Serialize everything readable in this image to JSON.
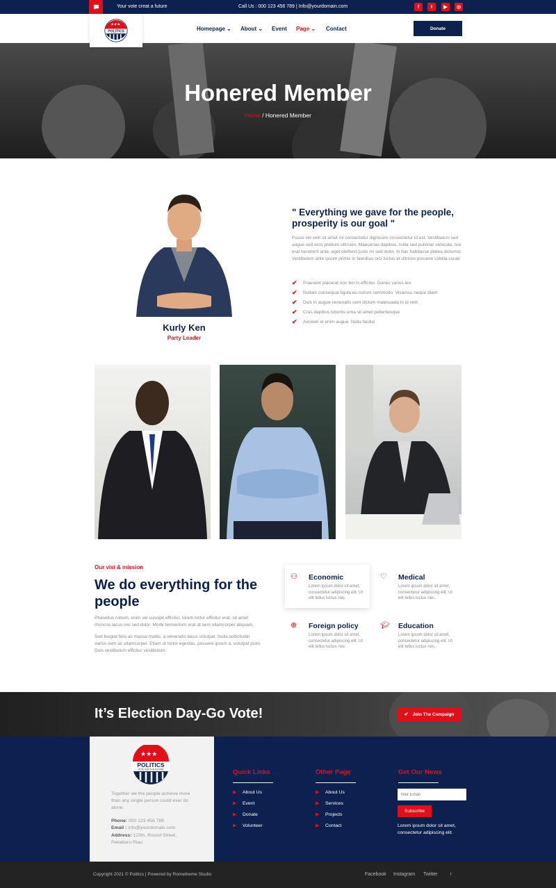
{
  "topbar": {
    "tagline": "Your vote creat a future",
    "contact": "Call Us : 000 123 456 789 | Info@yourdomain.com",
    "social": [
      "facebook-icon",
      "twitter-icon",
      "youtube-icon",
      "instagram-icon"
    ]
  },
  "nav": {
    "items": [
      "Homepage",
      "About",
      "Event",
      "Page",
      "Contact"
    ],
    "donate": "Donate"
  },
  "logo": {
    "text": "POLITICS",
    "tag": "VOTE FOR THE FUTURE"
  },
  "hero": {
    "title": "Honered Member",
    "breadcrumb_home": "Home",
    "breadcrumb_sep": " / ",
    "breadcrumb_current": "Honered Member"
  },
  "leader": {
    "name": "Kurly Ken",
    "role": "Party Leader",
    "quote": "\" Everything we gave for the people, prosperity is our goal \"",
    "intro": "Fusce vel velit sit amet mi consectetur dignissim consectetur id est. Vestibulum sed augue sed eros pretium ultricies. Maecenas dapibus, nulla sed pulvinar vehicula, nisi erat hendrerit ante, eget eleifend justo mi sed dolor. In hac habitasse platea dictumst. Vestibulum ante ipsum primis in faucibus orci luctus et ultrices posuere cubilia curae",
    "checks": [
      "Praesent placerat non leo in efficitur. Donec varius leo",
      "Nullam consequat ligula eu rutrum commodo. Vivamus neque diam",
      "Duis in augue venenatis sem dictum malesuada in id velit",
      "Cras dapibus lobortis urna sit amet pellentesque",
      "Aenean et enim augue. Nulla facilisi"
    ]
  },
  "mission": {
    "label": "Our visi & mission",
    "title": "We do everything for the people",
    "p1": "Phasellus rutrum, enim vel suscipit efficitur, lorem tortor efficitur erat, sit amet rhoncus lacus nisi sed dolor. Morbi fermentum erat at sem ullamcorper aliquam.",
    "p2": "Sed feugiat felis ac massa mattis, a venenatis lacus volutpat. Nulla sollicitudin varius sem ac ullamcorper. Etiam ut tortor egestas, posuere ipsum a, volutpat justo. Duis vestibulum efficitur vestibulum.",
    "services": [
      {
        "title": "Economic",
        "desc": "Lorem ipsum dolor sit amet, consectetur adipiscing elit. Ut elit tellus luctus nec."
      },
      {
        "title": "Medical",
        "desc": "Lorem ipsum dolor sit amet, consectetur adipiscing elit. Ut elit tellus luctus nec."
      },
      {
        "title": "Foreign policy",
        "desc": "Lorem ipsum dolor sit amet, consectetur adipiscing elit. Ut elit tellus luctus nec."
      },
      {
        "title": "Education",
        "desc": "Lorem ipsum dolor sit amet, consectetur adipiscing elit. Ut elit tellus luctus nec."
      }
    ]
  },
  "cta": {
    "title": "It’s Election Day-Go Vote!",
    "button": "Join The Campaign"
  },
  "footer": {
    "about": "Together we the people achieve more than any single person could ever do alone.",
    "phone_label": "Phone:",
    "phone": " 000 123 456 789",
    "email_label": "Email :",
    "email": " info@yourdomain.com",
    "address_label": "Address:",
    "address": " 123th, Round Street, Pekabaru Riau",
    "quick_title": "Quick Links",
    "quick": [
      "About Us",
      "Event",
      "Donate",
      "Volunteer"
    ],
    "other_title": "Other Page",
    "other": [
      "About Us",
      "Services",
      "Projects",
      "Contact"
    ],
    "news_title": "Get Our News",
    "email_placeholder": "Your Email",
    "subscribe": "Subscribe",
    "news_text": "Lorem ipsum dolor sit amet, consectetur adipiscing elit."
  },
  "bottom": {
    "copyright": "Copyright 2021 © Politics | Powered by Rometheme Studio",
    "links": [
      "Facebook",
      "Instagram",
      "Twitter"
    ],
    "top": "↑"
  }
}
